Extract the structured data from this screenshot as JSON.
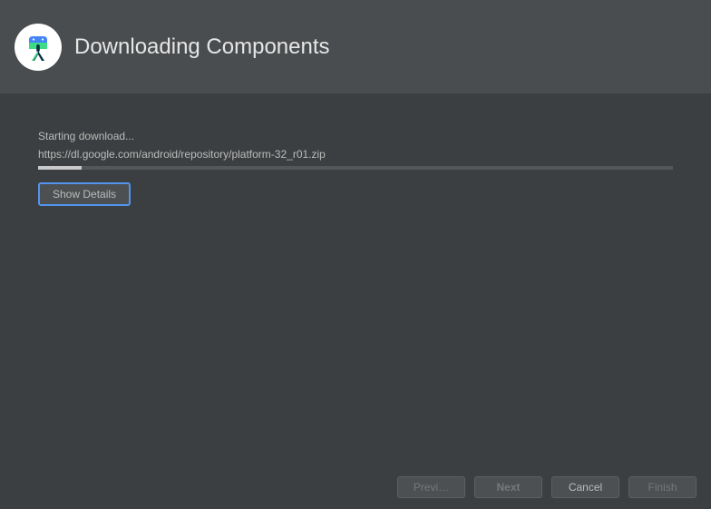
{
  "header": {
    "title": "Downloading Components"
  },
  "content": {
    "status": "Starting download...",
    "url": "https://dl.google.com/android/repository/platform-32_r01.zip",
    "progress_percent": 7,
    "show_details_label": "Show Details"
  },
  "footer": {
    "previous_label": "Previ…",
    "next_label": "Next",
    "cancel_label": "Cancel",
    "finish_label": "Finish"
  },
  "colors": {
    "accent": "#5394ec",
    "android_green": "#3ddc84",
    "android_blue": "#4285f4"
  }
}
